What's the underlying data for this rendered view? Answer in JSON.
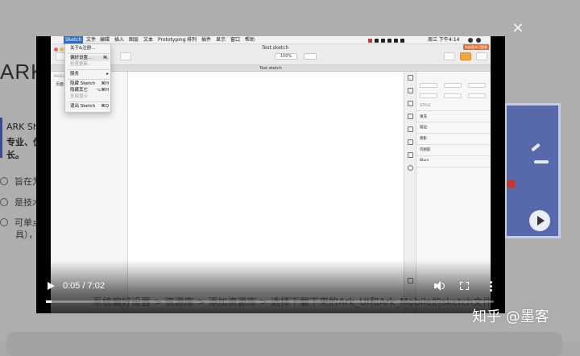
{
  "background_page": {
    "brand": "ARK",
    "intro_line1": "ARK Sha",
    "intro_line2": "专业、优",
    "intro_line3": "长。",
    "features": [
      "旨在为",
      "是技术",
      "可单点",
      "具），"
    ]
  },
  "overlay": {
    "close_label": "×"
  },
  "video": {
    "sketch_screen": {
      "menubar": {
        "apple_glyph": "",
        "app_menu": "Sketch",
        "items": [
          "文件",
          "编辑",
          "插入",
          "图层",
          "文本",
          "Prototyping",
          "排列",
          "插件",
          "显示",
          "窗口",
          "帮助"
        ],
        "clock": "周三 下午4:14"
      },
      "window_title": "Test.sketch",
      "document_tab": "Test.sketch",
      "zoom_level": "100%",
      "update_badge": "有新版本可更新",
      "left_pane": {
        "header": "PAGES",
        "page": "页面"
      },
      "app_menu_dropdown": [
        {
          "label": "关于&注册…",
          "shortcut": "",
          "disabled": false
        },
        {
          "label": "偏好设置…",
          "shortcut": "⌘,",
          "disabled": false,
          "highlighted": true
        },
        {
          "label": "检查更新…",
          "shortcut": "",
          "disabled": true
        },
        {
          "label": "服务",
          "shortcut": "▸",
          "disabled": false
        },
        {
          "label": "隐藏 Sketch",
          "shortcut": "⌘H",
          "disabled": false
        },
        {
          "label": "隐藏其它",
          "shortcut": "⌥⌘H",
          "disabled": false
        },
        {
          "label": "全部显示",
          "shortcut": "",
          "disabled": true
        },
        {
          "label": "退出 Sketch",
          "shortcut": "⌘Q",
          "disabled": false
        }
      ],
      "inspector": {
        "style_header": "STYLE",
        "rows": [
          "填充",
          "描边",
          "阴影",
          "内阴影",
          "Blurs"
        ]
      }
    },
    "subtitle": "系统偏好设置 > 资源库 > 添加资源库 > 选择下载下来的Ark_UI和Ark_Mobile的sketch文件",
    "current_time": "0:05",
    "duration": "7:02",
    "time_display": "0:05 / 7:02",
    "progress_fraction": 0.012
  },
  "watermark": "知乎 @墨客",
  "colors": {
    "accent_blue": "#2d6fd6",
    "badge_orange": "#e96a2e",
    "brand_navy": "#3c4a8c"
  }
}
